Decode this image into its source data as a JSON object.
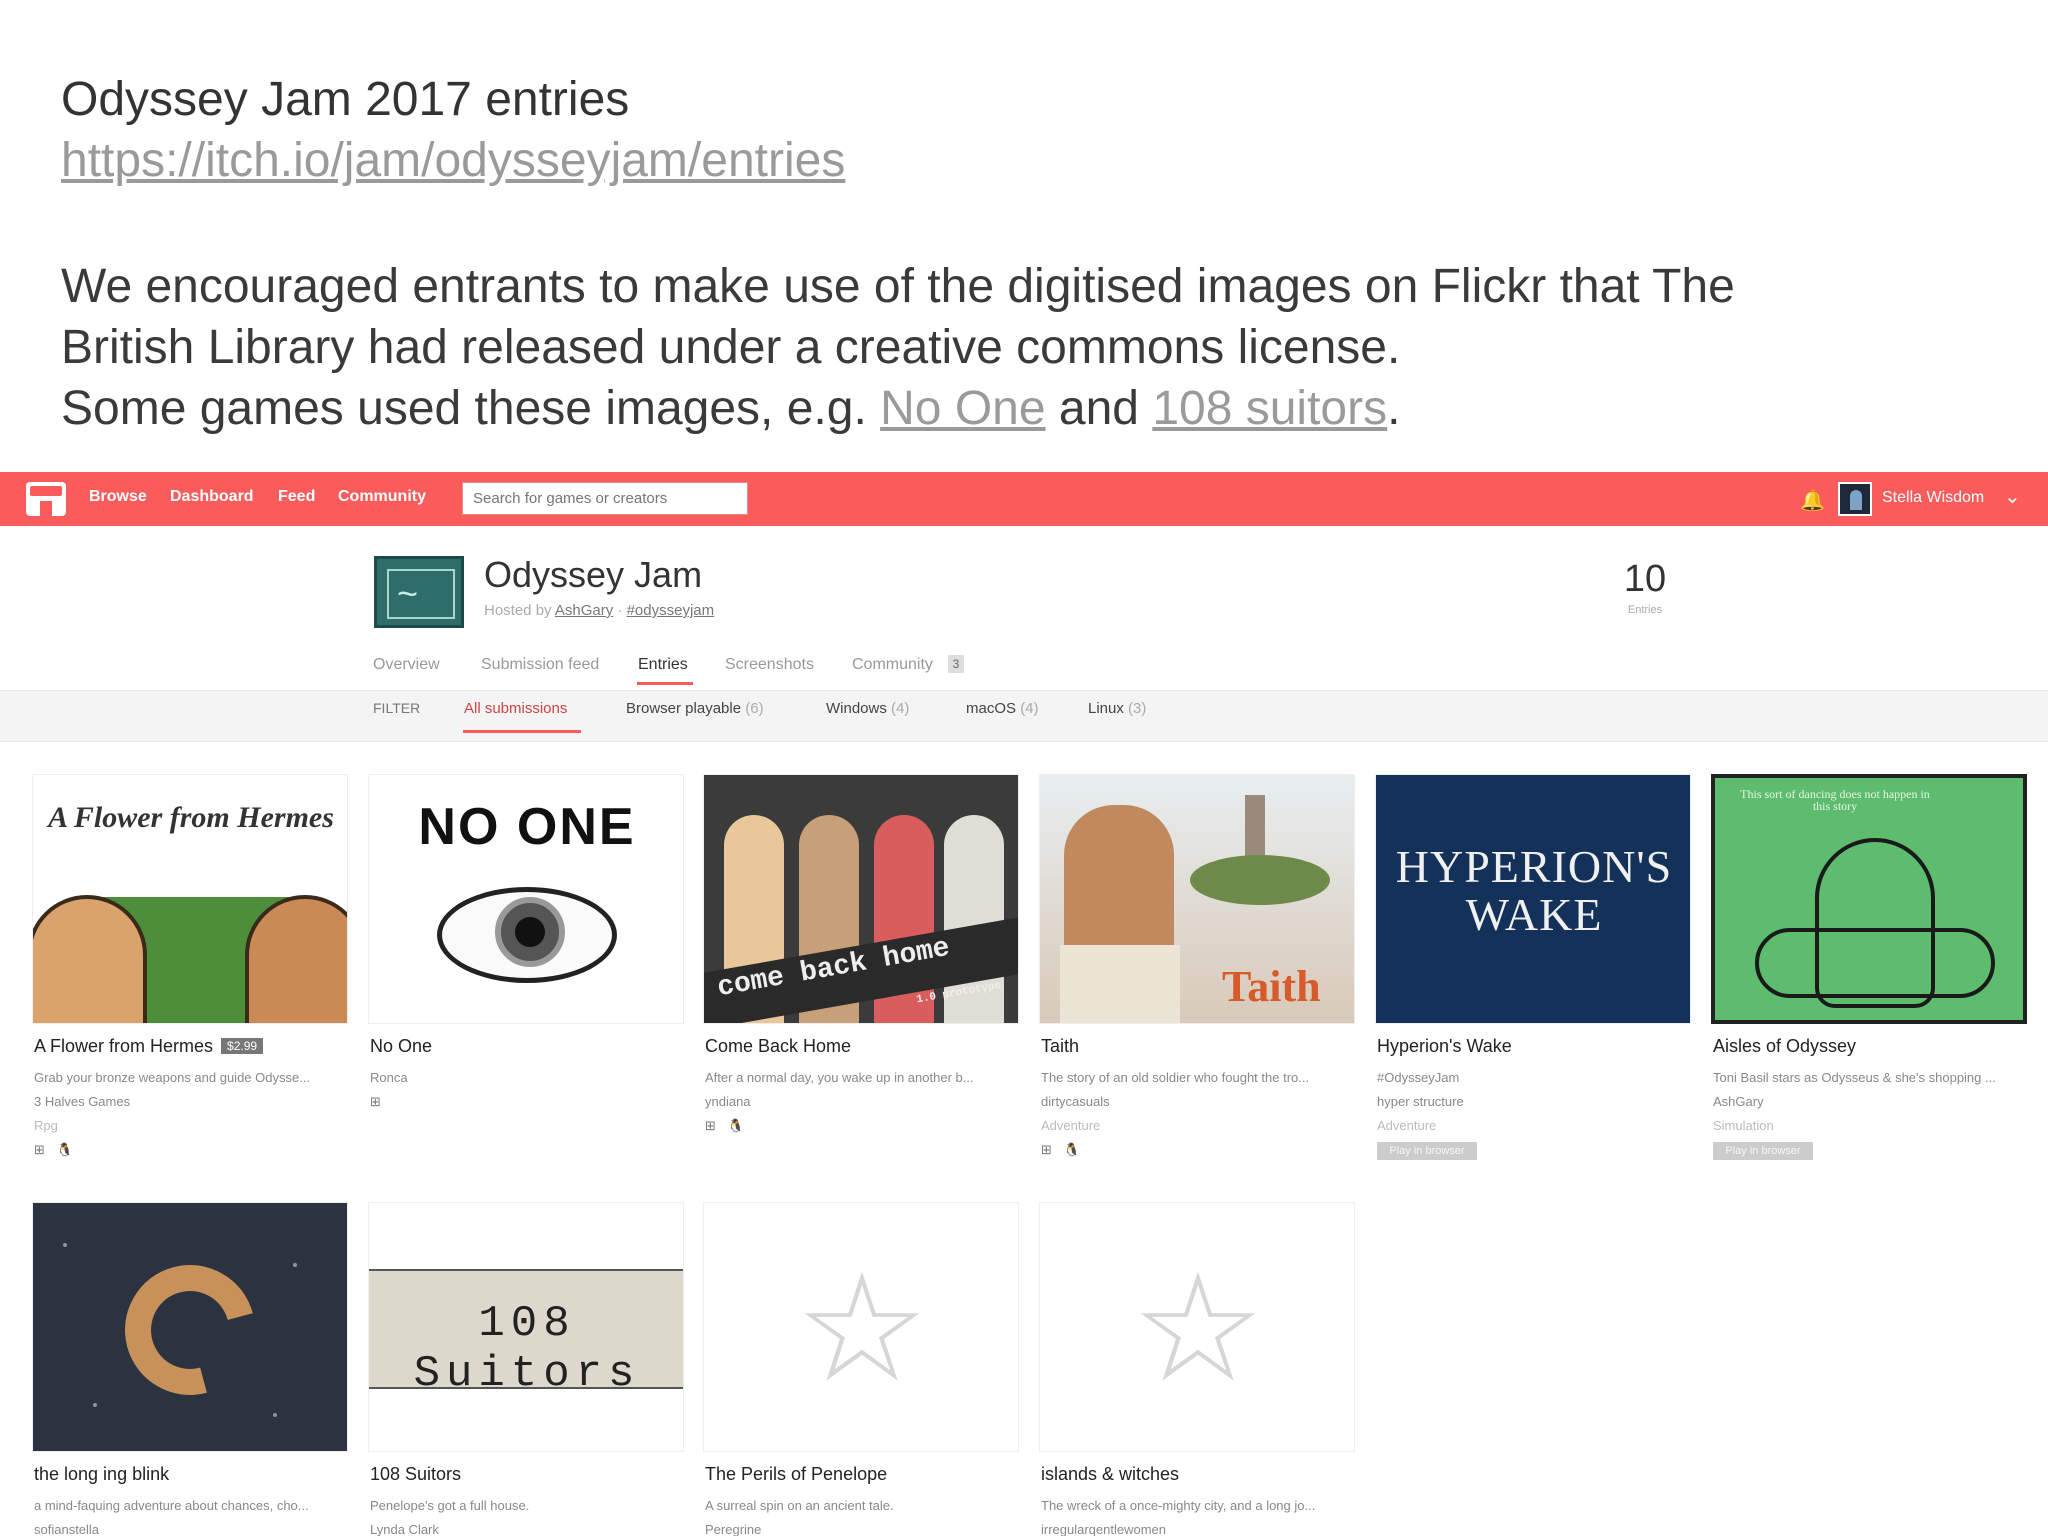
{
  "slide": {
    "title": "Odyssey Jam 2017 entries",
    "url": "https://itch.io/jam/odysseyjam/entries",
    "para1_line1": "We encouraged entrants to make use of the digitised images on Flickr that The",
    "para1_line2": "British Library had released under a creative commons license.",
    "para2_prefix": "Some games used these images, e.g. ",
    "para2_link1": "No One",
    "para2_mid": " and ",
    "para2_link2": "108 suitors",
    "para2_suffix": "."
  },
  "topbar": {
    "nav": [
      "Browse",
      "Dashboard",
      "Feed",
      "Community"
    ],
    "search_placeholder": "Search for games or creators",
    "username": "Stella Wisdom",
    "accent": "#fa5c5c"
  },
  "jam": {
    "title": "Odyssey Jam",
    "hosted_by_prefix": "Hosted by ",
    "host": "AshGary",
    "separator": " · ",
    "hashtag": "#odysseyjam",
    "entries_count": "10",
    "entries_label": "Entries"
  },
  "tabs": {
    "overview": "Overview",
    "submission_feed": "Submission feed",
    "entries": "Entries",
    "screenshots": "Screenshots",
    "community": "Community",
    "community_count": "3"
  },
  "filters": {
    "label": "FILTER",
    "all": "All submissions",
    "browser": "Browser playable",
    "browser_count": "(6)",
    "windows": "Windows",
    "windows_count": "(4)",
    "macos": "macOS",
    "macos_count": "(4)",
    "linux": "Linux",
    "linux_count": "(3)"
  },
  "games": [
    {
      "title": "A Flower from Hermes",
      "price": "$2.99",
      "desc": "Grab your bronze weapons and guide Odysse...",
      "author": "3 Halves Games",
      "genre": "Rpg",
      "platforms": "⊞ 🐧 ",
      "art_text": "A Flower from Hermes"
    },
    {
      "title": "No One",
      "desc": "Ronca",
      "platforms": "⊞ ",
      "art_text": "NO ONE"
    },
    {
      "title": "Come Back Home",
      "desc": "After a normal day, you wake up in another b...",
      "author": "yndiana",
      "platforms": "⊞ 🐧 ",
      "art_text": "come back home",
      "art_sub": "1.0 prototype"
    },
    {
      "title": "Taith",
      "desc": "The story of an old soldier who fought the tro...",
      "author": "dirtycasuals",
      "genre": "Adventure",
      "platforms": "⊞ 🐧 ",
      "art_text": "Taith"
    },
    {
      "title": "Hyperion's Wake",
      "desc": "#OdysseyJam",
      "author": "hyper structure",
      "genre": "Adventure",
      "badge": "Play in browser",
      "art_text": "HYPERION'S WAKE"
    },
    {
      "title": "Aisles of Odyssey",
      "desc": "Toni Basil stars as Odysseus & she's shopping ...",
      "author": "AshGary",
      "genre": "Simulation",
      "badge": "Play in browser",
      "art_text": "This sort of dancing does not happen in this story"
    },
    {
      "title": "the long ing blink",
      "desc": "a mind-faquing adventure about chances, cho...",
      "author": "sofianstella"
    },
    {
      "title": "108 Suitors",
      "desc": "Penelope's got a full house.",
      "author": "Lynda Clark",
      "art_text": "108 Suitors"
    },
    {
      "title": "The Perils of Penelope",
      "desc": "A surreal spin on an ancient tale.",
      "author": "Peregrine"
    },
    {
      "title": "islands & witches",
      "desc": "The wreck of a once-mighty city, and a long jo...",
      "author": "irregularqentlewomen"
    }
  ]
}
